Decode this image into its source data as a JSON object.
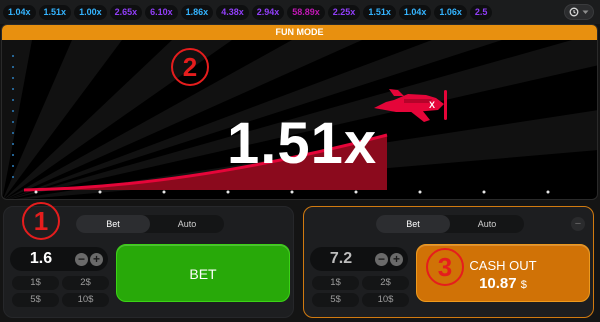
{
  "history": {
    "chips": [
      {
        "value": "1.04x",
        "tone": "blue"
      },
      {
        "value": "1.51x",
        "tone": "blue"
      },
      {
        "value": "1.00x",
        "tone": "blue"
      },
      {
        "value": "2.65x",
        "tone": "purple"
      },
      {
        "value": "6.10x",
        "tone": "purple"
      },
      {
        "value": "1.86x",
        "tone": "blue"
      },
      {
        "value": "4.38x",
        "tone": "purple"
      },
      {
        "value": "2.94x",
        "tone": "purple"
      },
      {
        "value": "58.89x",
        "tone": "pink"
      },
      {
        "value": "2.25x",
        "tone": "purple"
      },
      {
        "value": "1.51x",
        "tone": "blue"
      },
      {
        "value": "1.04x",
        "tone": "blue"
      },
      {
        "value": "1.06x",
        "tone": "blue"
      },
      {
        "value": "2.5",
        "tone": "purple"
      }
    ],
    "history_icon": "history-clock-icon",
    "dropdown_icon": "chevron-down-icon"
  },
  "game": {
    "mode_label": "FUN MODE",
    "multiplier": "1.51x",
    "plane_icon": "airplane-icon",
    "colors": {
      "curve": "#e50539",
      "fill": "#8b0a1d",
      "mode_bar": "#e8900f"
    }
  },
  "annotations": {
    "one": "1",
    "two": "2",
    "three": "3"
  },
  "panel1": {
    "tabs": [
      "Bet",
      "Auto"
    ],
    "active_tab": "Bet",
    "amount": "1.6",
    "quick": [
      "1$",
      "2$",
      "5$",
      "10$"
    ],
    "button_label": "BET"
  },
  "panel2": {
    "tabs": [
      "Bet",
      "Auto"
    ],
    "active_tab": "Bet",
    "amount": "7.2",
    "quick": [
      "1$",
      "2$",
      "5$",
      "10$"
    ],
    "button_label": "CASH OUT",
    "cash_value": "10.87",
    "cash_currency": "$"
  }
}
